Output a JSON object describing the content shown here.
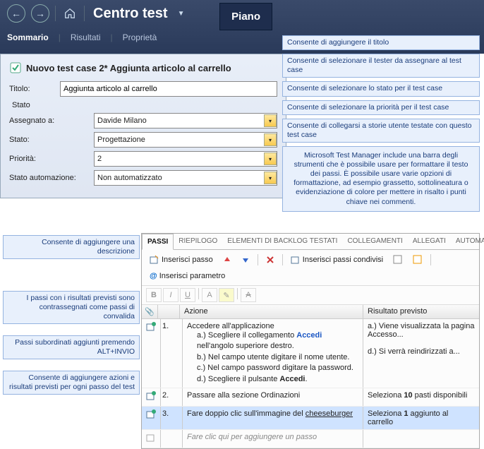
{
  "header": {
    "title": "Centro test",
    "tab": "Piano",
    "subnav": [
      "Sommario",
      "Risultati",
      "Proprietà"
    ]
  },
  "form": {
    "heading": "Nuovo test case 2* Aggiunta articolo al carrello",
    "title_label": "Titolo:",
    "title_value": "Aggiunta articolo al carrello",
    "stato_label": "Stato",
    "fields": {
      "assegnato": {
        "label": "Assegnato a:",
        "value": "Davide Milano"
      },
      "stato": {
        "label": "Stato:",
        "value": "Progettazione"
      },
      "priorita": {
        "label": "Priorità:",
        "value": "2"
      },
      "automazione": {
        "label": "Stato automazione:",
        "value": "Non automatizzato"
      }
    }
  },
  "callouts_right": [
    "Consente di aggiungere il titolo",
    "Consente di selezionare il tester da assegnare al test case",
    "Consente di selezionare lo stato per il test case",
    "Consente di selezionare la priorità per il test case",
    "Consente di collegarsi a storie utente testate con questo test case",
    "Microsoft Test Manager include una barra degli strumenti che è possibile usare per formattare il testo dei passi. È possibile usare varie opzioni di formattazione, ad esempio grassetto, sottolineatura o evidenziazione di colore per mettere in risalto i punti chiave nei commenti."
  ],
  "callouts_left": [
    "Consente di aggiungere una descrizione",
    "I passi con i risultati previsti sono contrassegnati come passi di convalida",
    "Passi subordinati aggiunti premendo ALT+INVIO",
    "Consente di aggiungere azioni e risultati previsti per ogni passo del test"
  ],
  "steps": {
    "tabs": [
      "PASSI",
      "RIEPILOGO",
      "ELEMENTI DI BACKLOG TESTATI",
      "COLLEGAMENTI",
      "ALLEGATI",
      "AUTOMAZIONE ASSOCIATA..."
    ],
    "toolbar": {
      "ins_passo": "Inserisci passo",
      "ins_cond": "Inserisci passi condivisi",
      "ins_param": "Inserisci parametro"
    },
    "columns": {
      "azione": "Azione",
      "risultato": "Risultato previsto"
    },
    "rows": [
      {
        "num": "1.",
        "validated": true,
        "action_main": "Accedere all'applicazione",
        "subs": [
          {
            "t": "a.) Scegliere il collegamento ",
            "link": "Accedi",
            "t2": " nell'angolo superiore destro."
          },
          {
            "t": "b.) Nel campo utente digitare il nome utente."
          },
          {
            "t": "c.) Nel campo password digitare la password."
          },
          {
            "t": "d.) Scegliere il pulsante ",
            "bold": "Accedi",
            "t2": "."
          }
        ],
        "results": [
          "a.) Viene visualizzata la pagina Accesso...",
          "",
          "d.) Si verrà reindirizzati a..."
        ]
      },
      {
        "num": "2.",
        "validated": true,
        "action_main": "Passare alla sezione Ordinazioni",
        "result_html": "Seleziona <b>10</b> pasti disponibili"
      },
      {
        "num": "3.",
        "validated": true,
        "selected": true,
        "action_html": "Fare doppio clic sull'immagine del <u>cheeseburger</u>",
        "result_html": "Seleziona <b>1</b> aggiunto al carrello"
      }
    ],
    "ghost": "Fare clic qui per aggiungere un passo"
  }
}
